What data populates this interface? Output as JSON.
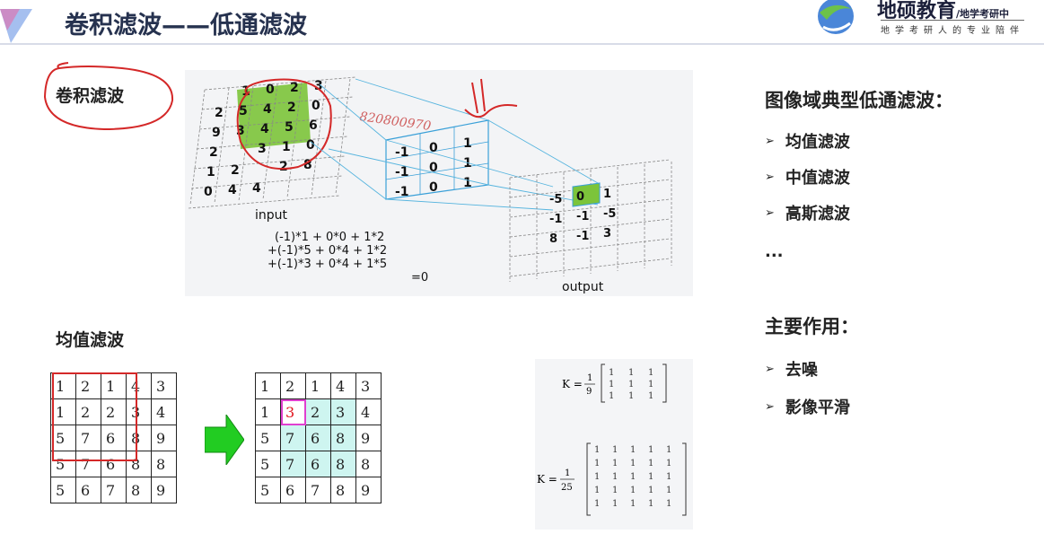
{
  "slide": {
    "title": "卷积滤波——低通滤波",
    "logo_main": "地硕教育",
    "logo_tag": "/地学考研中",
    "logo_sub": "地学考研人的专业陪伴"
  },
  "labels": {
    "conv_filter": "卷积滤波",
    "mean_filter": "均值滤波"
  },
  "conv_figure": {
    "input_label": "input",
    "output_label": "output",
    "watermark": "820800970",
    "input_rows": [
      [
        "",
        "1",
        "0",
        "2",
        "3"
      ],
      [
        "2",
        "5",
        "4",
        "2",
        "0"
      ],
      [
        "9",
        "3",
        "4",
        "5",
        "6"
      ],
      [
        "2",
        "",
        "3",
        "1",
        "0"
      ],
      [
        "1",
        "2",
        "",
        "2",
        "8"
      ],
      [
        "0",
        "4",
        "4",
        "",
        ""
      ]
    ],
    "kernel_rows": [
      [
        "-1",
        "0",
        "1"
      ],
      [
        "-1",
        "0",
        "1"
      ],
      [
        "-1",
        "0",
        "1"
      ]
    ],
    "output_rows": [
      [
        "-5",
        "0",
        "1"
      ],
      [
        "-1",
        "-1",
        "-5"
      ],
      [
        "8",
        "-1",
        "3"
      ]
    ],
    "formula": [
      "(-1)*1 + 0*0 + 1*2",
      "+(-1)*5 + 0*4 + 1*2",
      "+(-1)*3 + 0*4 + 1*5",
      "=0"
    ]
  },
  "matrix_before": [
    [
      "1",
      "2",
      "1",
      "4",
      "3"
    ],
    [
      "1",
      "2",
      "2",
      "3",
      "4"
    ],
    [
      "5",
      "7",
      "6",
      "8",
      "9"
    ],
    [
      "5",
      "7",
      "6",
      "8",
      "8"
    ],
    [
      "5",
      "6",
      "7",
      "8",
      "9"
    ]
  ],
  "matrix_after": [
    [
      "1",
      "2",
      "1",
      "4",
      "3"
    ],
    [
      "1",
      "3",
      "2",
      "3",
      "4"
    ],
    [
      "5",
      "7",
      "6",
      "8",
      "9"
    ],
    [
      "5",
      "7",
      "6",
      "8",
      "8"
    ],
    [
      "5",
      "6",
      "7",
      "8",
      "9"
    ]
  ],
  "kernels": {
    "k3_prefix": "K =",
    "k3_num": "1",
    "k3_den": "9",
    "k5_prefix": "K =",
    "k5_num": "1",
    "k5_den": "25"
  },
  "right_panel": {
    "heading1": "图像域典型低通滤波：",
    "items1": [
      "均值滤波",
      "中值滤波",
      "高斯滤波"
    ],
    "ellipsis": "...",
    "heading2": "主要作用：",
    "items2": [
      "去噪",
      "影像平滑"
    ]
  },
  "colors": {
    "title": "#26324f",
    "highlight_green": "#7cc43a",
    "cyan_cell": "#cef5f0",
    "red_box": "#d42828",
    "magenta_box": "#e040d0",
    "arrow_green": "#22cc22"
  }
}
